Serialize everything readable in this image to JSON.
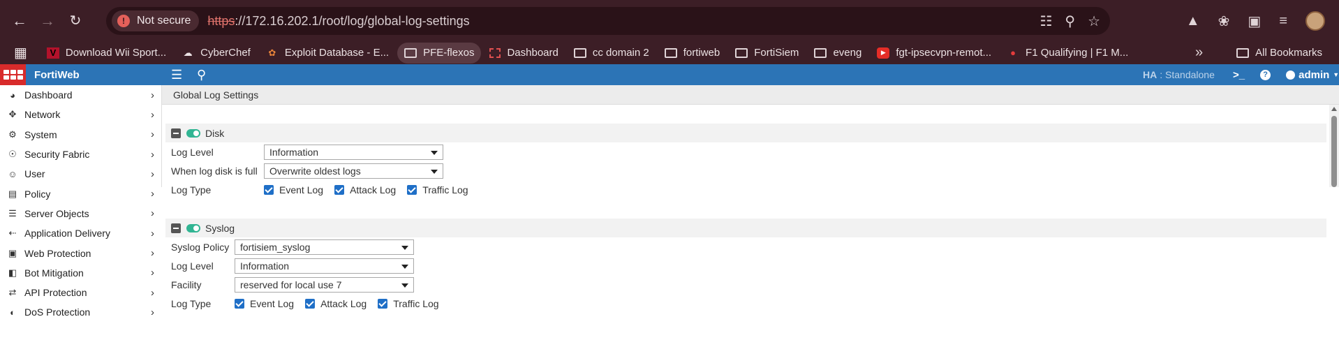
{
  "browser": {
    "security_label": "Not secure",
    "url_scheme": "https",
    "url_rest": "://172.16.202.1/root/log/global-log-settings"
  },
  "bookmarks": [
    {
      "label": "Download Wii Sport...",
      "icon": "wii-favicon"
    },
    {
      "label": "CyberChef",
      "icon": "chef-hat-icon"
    },
    {
      "label": "Exploit Database - E...",
      "icon": "exploit-db-icon"
    },
    {
      "label": "PFE-flexos",
      "icon": "folder-icon"
    },
    {
      "label": "Dashboard",
      "icon": "dashboard-favicon"
    },
    {
      "label": "cc domain 2",
      "icon": "folder-icon"
    },
    {
      "label": "fortiweb",
      "icon": "folder-icon"
    },
    {
      "label": "FortiSiem",
      "icon": "folder-icon"
    },
    {
      "label": "eveng",
      "icon": "folder-icon"
    },
    {
      "label": "fgt-ipsecvpn-remot...",
      "icon": "youtube-icon"
    },
    {
      "label": "F1 Qualifying | F1 M...",
      "icon": "f1-icon"
    }
  ],
  "all_bookmarks": "All Bookmarks",
  "app": {
    "brand": "FortiWeb",
    "ha_label": "HA",
    "ha_value": ": Standalone",
    "user": "admin"
  },
  "sidebar": {
    "items": [
      {
        "label": "Dashboard",
        "icon": "dashboard-icon"
      },
      {
        "label": "Network",
        "icon": "network-icon"
      },
      {
        "label": "System",
        "icon": "gear-icon"
      },
      {
        "label": "Security Fabric",
        "icon": "fabric-icon"
      },
      {
        "label": "User",
        "icon": "user-icon"
      },
      {
        "label": "Policy",
        "icon": "policy-icon"
      },
      {
        "label": "Server Objects",
        "icon": "server-icon"
      },
      {
        "label": "Application Delivery",
        "icon": "delivery-icon"
      },
      {
        "label": "Web Protection",
        "icon": "lock-icon"
      },
      {
        "label": "Bot Mitigation",
        "icon": "bot-icon"
      },
      {
        "label": "API Protection",
        "icon": "api-icon"
      },
      {
        "label": "DoS Protection",
        "icon": "shield-icon"
      }
    ]
  },
  "page": {
    "title": "Global Log Settings"
  },
  "disk": {
    "title": "Disk",
    "enabled": true,
    "log_level_label": "Log Level",
    "log_level_value": "Information",
    "full_label": "When log disk is full",
    "full_value": "Overwrite oldest logs",
    "log_type_label": "Log Type",
    "types": [
      "Event Log",
      "Attack Log",
      "Traffic Log"
    ]
  },
  "syslog": {
    "title": "Syslog",
    "enabled": true,
    "policy_label": "Syslog Policy",
    "policy_value": "fortisiem_syslog",
    "log_level_label": "Log Level",
    "log_level_value": "Information",
    "facility_label": "Facility",
    "facility_value": "reserved for local use 7",
    "log_type_label": "Log Type",
    "types": [
      "Event Log",
      "Attack Log",
      "Traffic Log"
    ]
  }
}
